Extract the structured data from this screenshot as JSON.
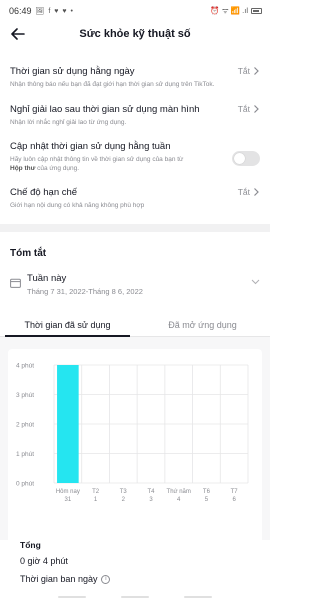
{
  "status_bar": {
    "time": "06:49",
    "left_icons": "🖼 f ♥ ♥ •",
    "right_icons": "⏰ ᯤ 📶 .ıl"
  },
  "header": {
    "title": "Sức khỏe kỹ thuật số"
  },
  "settings": [
    {
      "title": "Thời gian sử dụng hằng ngày",
      "description": "Nhận thông báo nếu bạn đã đạt giới hạn thời gian sử dụng trên TikTok.",
      "value": "Tắt"
    },
    {
      "title": "Nghỉ giải lao sau thời gian sử dụng màn hình",
      "description": "Nhận lời nhắc nghỉ giải lao từ ứng dụng.",
      "value": "Tắt"
    },
    {
      "title": "Cập nhật thời gian sử dụng hằng tuần",
      "description_before": "Hãy luôn cập nhật thông tin về thời gian sử dụng của bạn từ ",
      "description_bold": "Hộp thư",
      "description_after": " của ứng dụng.",
      "toggle_on": false
    },
    {
      "title": "Chế độ hạn chế",
      "description": "Giới hạn nội dung có khả năng không phù hợp",
      "value": "Tắt"
    }
  ],
  "summary": {
    "title": "Tóm tắt",
    "week_label": "Tuần này",
    "week_range": "Tháng 7 31, 2022-Tháng 8 6, 2022"
  },
  "tabs": [
    {
      "label": "Thời gian đã sử dụng",
      "active": true
    },
    {
      "label": "Đã mở ứng dụng",
      "active": false
    }
  ],
  "chart_data": {
    "type": "bar",
    "categories": [
      "Hôm nay\n31",
      "T2\n1",
      "T3\n2",
      "T4\n3",
      "Thứ năm\n4",
      "T6\n5",
      "T7\n6"
    ],
    "category_top": [
      "Hôm nay",
      "T2",
      "T3",
      "T4",
      "Thứ năm",
      "T6",
      "T7"
    ],
    "category_bottom": [
      "31",
      "1",
      "2",
      "3",
      "4",
      "5",
      "6"
    ],
    "values": [
      4,
      0,
      0,
      0,
      0,
      0,
      0
    ],
    "ytick_labels": [
      "4 phút",
      "3 phút",
      "2 phút",
      "1 phút",
      "0 phút"
    ],
    "yticks": [
      4,
      3,
      2,
      1,
      0
    ],
    "ylim": [
      0,
      4
    ],
    "bar_color": "#25e5f0",
    "grid_color": "#e6e6e7"
  },
  "totals": {
    "label": "Tổng",
    "value": "0 giờ 4 phút",
    "daytime_label": "Thời gian ban ngày",
    "info_icon": "i"
  },
  "colors": {
    "text_primary": "#161823",
    "text_secondary": "#8a8b91",
    "accent_bar": "#25e5f0"
  }
}
